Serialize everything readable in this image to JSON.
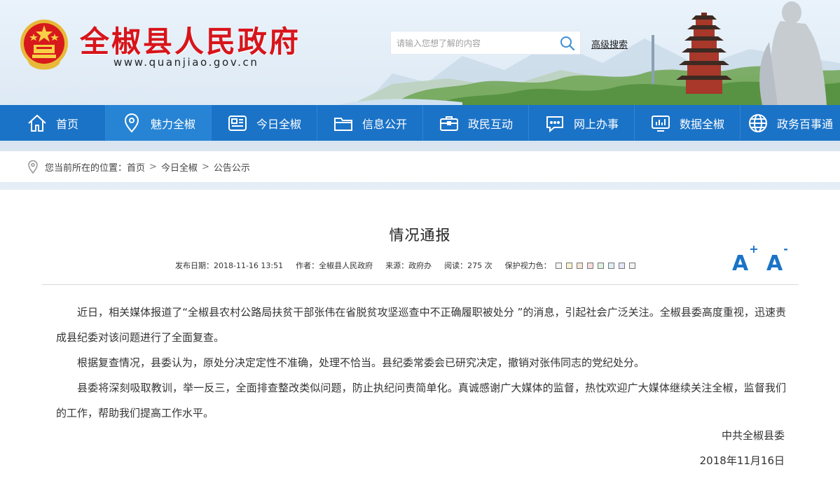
{
  "header": {
    "title": "全椒县人民政府",
    "url": "www.quanjiao.gov.cn",
    "search_placeholder": "请输入您想了解的内容",
    "advanced_search": "高级搜索"
  },
  "nav": [
    {
      "label": "首页",
      "icon": "home-icon"
    },
    {
      "label": "魅力全椒",
      "icon": "location-pin-icon"
    },
    {
      "label": "今日全椒",
      "icon": "news-icon"
    },
    {
      "label": "信息公开",
      "icon": "folder-icon"
    },
    {
      "label": "政民互动",
      "icon": "briefcase-icon"
    },
    {
      "label": "网上办事",
      "icon": "chat-icon"
    },
    {
      "label": "数据全椒",
      "icon": "chart-icon"
    },
    {
      "label": "政务百事通",
      "icon": "globe-icon"
    }
  ],
  "breadcrumb": {
    "prefix": "您当前所在的位置：",
    "items": [
      "首页",
      "今日全椒",
      "公告公示"
    ],
    "separator": ">"
  },
  "article": {
    "title": "情况通报",
    "meta": {
      "date": "发布日期：2018-11-16 13:51",
      "author": "作者：全椒县人民政府",
      "source": "来源：政府办",
      "reads": "阅读：275 次",
      "eye_care": "保护视力色："
    },
    "swatches": [
      "#f5f5f5",
      "#fdf2d0",
      "#f6e6d4",
      "#f9dede",
      "#dff3df",
      "#dff0f5",
      "#e6e6f8",
      "#f2f2f2"
    ],
    "font_larger": "A",
    "font_larger_sign": "+",
    "font_smaller": "A",
    "font_smaller_sign": "-",
    "paragraphs": [
      "近日，相关媒体报道了“全椒县农村公路局扶贫干部张伟在省脱贫攻坚巡查中不正确履职被处分 ”的消息，引起社会广泛关注。全椒县委高度重视，迅速责成县纪委对该问题进行了全面复查。",
      "根据复查情况，县委认为，原处分决定定性不准确，处理不恰当。县纪委常委会已研究决定，撤销对张伟同志的党纪处分。",
      "县委将深刻吸取教训，举一反三，全面排查整改类似问题，防止执纪问责简单化。真诚感谢广大媒体的监督，热忱欢迎广大媒体继续关注全椒，监督我们的工作，帮助我们提高工作水平。"
    ],
    "signoff": "中共全椒县委",
    "date": "2018年11月16日"
  },
  "colors": {
    "nav_bg": "#1b73c7",
    "title_red": "#d7151b",
    "accent_blue": "#1b73c7"
  }
}
